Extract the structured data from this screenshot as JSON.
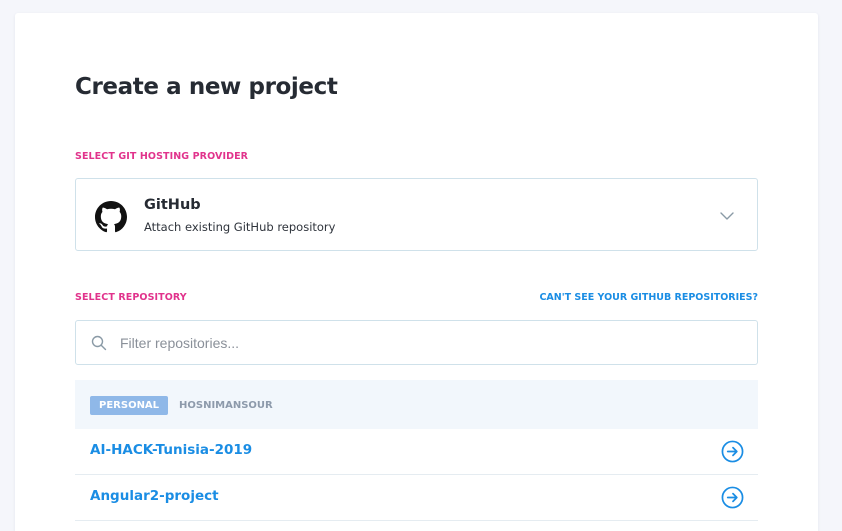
{
  "page": {
    "title": "Create a new project"
  },
  "provider": {
    "section_label": "SELECT GIT HOSTING PROVIDER",
    "name": "GitHub",
    "description": "Attach existing GitHub repository",
    "icon": "github-icon"
  },
  "repository": {
    "section_label": "SELECT REPOSITORY",
    "help_link": "CAN'T SEE YOUR GITHUB REPOSITORIES?",
    "search": {
      "placeholder": "Filter repositories...",
      "value": ""
    },
    "account_type": "PERSONAL",
    "account_name": "HOSNIMANSOUR",
    "items": [
      {
        "name": "AI-HACK-Tunisia-2019"
      },
      {
        "name": "Angular2-project"
      }
    ]
  },
  "colors": {
    "accent_pink": "#e1338c",
    "link_blue": "#1a8de4",
    "badge_blue": "#8fb8e8"
  }
}
